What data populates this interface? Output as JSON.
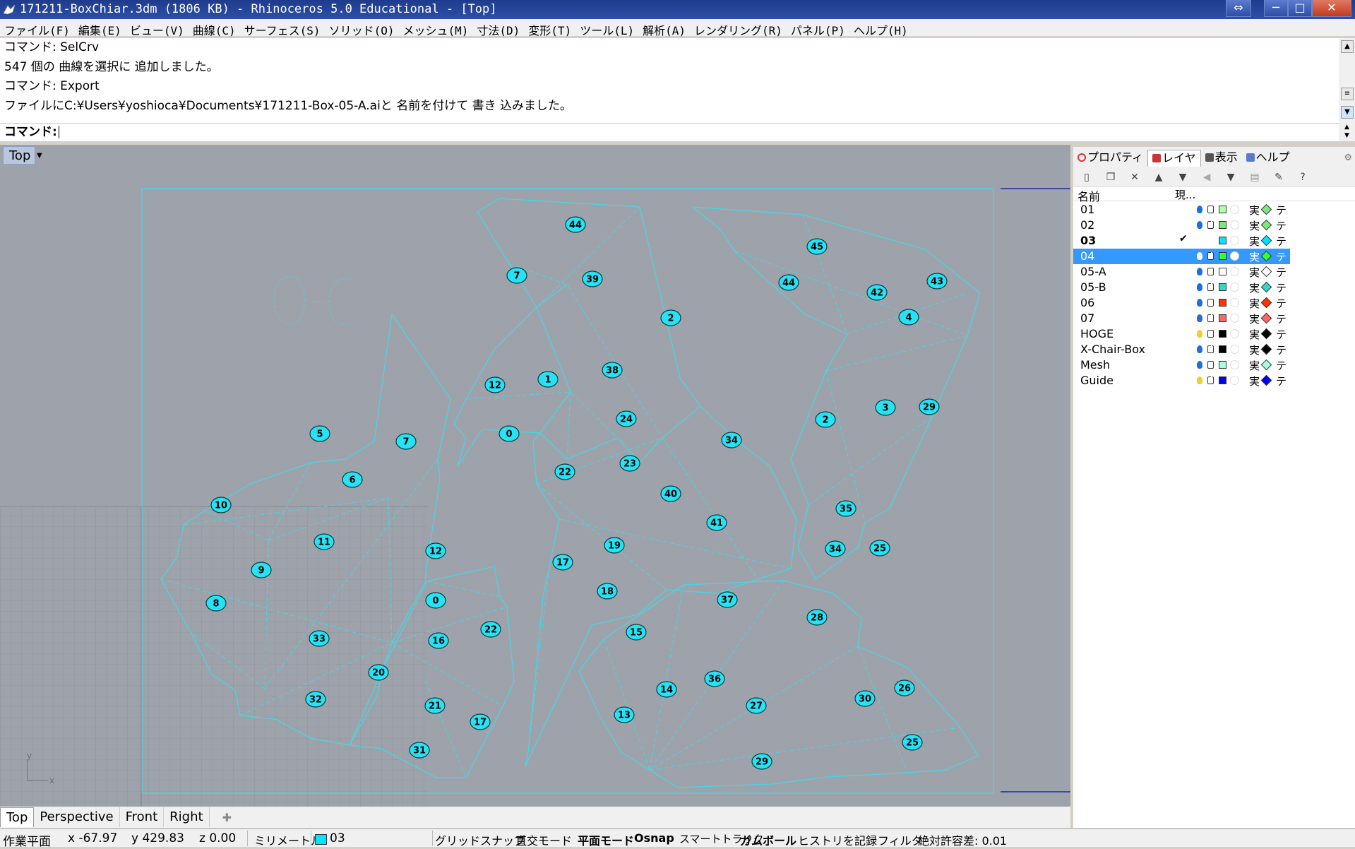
{
  "window": {
    "title": "171211-BoxChiar.3dm (1806 KB) - Rhinoceros 5.0 Educational - [Top]",
    "buttons": {
      "resize": "⇔",
      "minimize": "─",
      "maximize": "□",
      "close": "✕"
    }
  },
  "menu": [
    "ファイル(F)",
    "編集(E)",
    "ビュー(V)",
    "曲線(C)",
    "サーフェス(S)",
    "ソリッド(O)",
    "メッシュ(M)",
    "寸法(D)",
    "変形(T)",
    "ツール(L)",
    "解析(A)",
    "レンダリング(R)",
    "パネル(P)",
    "ヘルプ(H)"
  ],
  "command": {
    "history": [
      "コマンド: SelCrv",
      "547 個の 曲線を選択に 追加しました。",
      "コマンド: Export",
      "ファイルにC:¥Users¥yoshioca¥Documents¥171211-Box-05-A.aiと 名前を付けて 書き 込みました。"
    ],
    "prompt": "コマンド:"
  },
  "viewport": {
    "label": "Top",
    "accent_color": "#45d7e6",
    "background": "#9ea3ab",
    "axis_labels": {
      "y": "y",
      "x": "x"
    },
    "ghost_text": "0-C"
  },
  "viewport_tabs": [
    "Top",
    "Perspective",
    "Front",
    "Right"
  ],
  "panel": {
    "tabs": [
      "プロパティ",
      "レイヤ",
      "表示",
      "ヘルプ"
    ],
    "header": {
      "name": "名前",
      "current": "現..."
    },
    "layers": [
      {
        "name": "01",
        "current": "",
        "color": "#b0ffb0",
        "diamond": "#7ee87e",
        "bulb": "#1e6fd8",
        "selected": false
      },
      {
        "name": "02",
        "current": "",
        "color": "#7ee87e",
        "diamond": "#7ee87e",
        "bulb": "#1e6fd8",
        "selected": false
      },
      {
        "name": "03",
        "current": "✔",
        "color": "#00e5ff",
        "diamond": "#00e5ff",
        "bulb": "",
        "selected": false
      },
      {
        "name": "04",
        "current": "",
        "color": "#33ff33",
        "diamond": "#33ff33",
        "bulb": "#ffffff",
        "selected": true
      },
      {
        "name": "05-A",
        "current": "",
        "color": "#ffffff",
        "diamond": "#ffffff",
        "bulb": "#1e6fd8",
        "selected": false
      },
      {
        "name": "05-B",
        "current": "",
        "color": "#33d6c8",
        "diamond": "#33d6c8",
        "bulb": "#1e6fd8",
        "selected": false
      },
      {
        "name": "06",
        "current": "",
        "color": "#ff3300",
        "diamond": "#ff3300",
        "bulb": "#1e6fd8",
        "selected": false
      },
      {
        "name": "07",
        "current": "",
        "color": "#ff6666",
        "diamond": "#ff6666",
        "bulb": "#1e6fd8",
        "selected": false
      },
      {
        "name": "HOGE",
        "current": "",
        "color": "#000000",
        "diamond": "#000000",
        "bulb": "#f0d030",
        "selected": false
      },
      {
        "name": "X-Chair-Box",
        "current": "",
        "color": "#000000",
        "diamond": "#000000",
        "bulb": "#1e6fd8",
        "selected": false
      },
      {
        "name": "Mesh",
        "current": "",
        "color": "#a8ffe0",
        "diamond": "#a8ffe0",
        "bulb": "#1e6fd8",
        "selected": false
      },
      {
        "name": "Guide",
        "current": "",
        "color": "#0000ff",
        "diamond": "#0000ff",
        "bulb": "#f0d030",
        "selected": false
      }
    ],
    "layer_material_glyph": "実",
    "layer_print_glyph": "テ"
  },
  "status": {
    "plane": "作業平面",
    "x": "x -67.97",
    "y": "y 429.83",
    "z": "z 0.00",
    "units": "ミリメートル",
    "layer": "03",
    "layer_color": "#00e5ff",
    "toggles": [
      "グリッドスナップ",
      "直交モード",
      "平面モード",
      "Osnap",
      "スマートトラック",
      "ガムボール",
      "ヒストリを記録",
      "フィルタ"
    ],
    "tolerance": "絶対許容差: 0.01"
  },
  "labels": [
    "44",
    "39",
    "7",
    "2",
    "38",
    "1",
    "12",
    "0",
    "24",
    "23",
    "22",
    "34",
    "40",
    "41",
    "19",
    "17",
    "18",
    "45",
    "44",
    "42",
    "43",
    "4",
    "3",
    "29",
    "2",
    "35",
    "34",
    "25",
    "5",
    "7",
    "6",
    "10",
    "11",
    "12",
    "9",
    "8",
    "0",
    "22",
    "16",
    "33",
    "20",
    "32",
    "21",
    "17",
    "31",
    "37",
    "28",
    "15",
    "36",
    "14",
    "27",
    "13",
    "30",
    "26",
    "25",
    "29"
  ]
}
